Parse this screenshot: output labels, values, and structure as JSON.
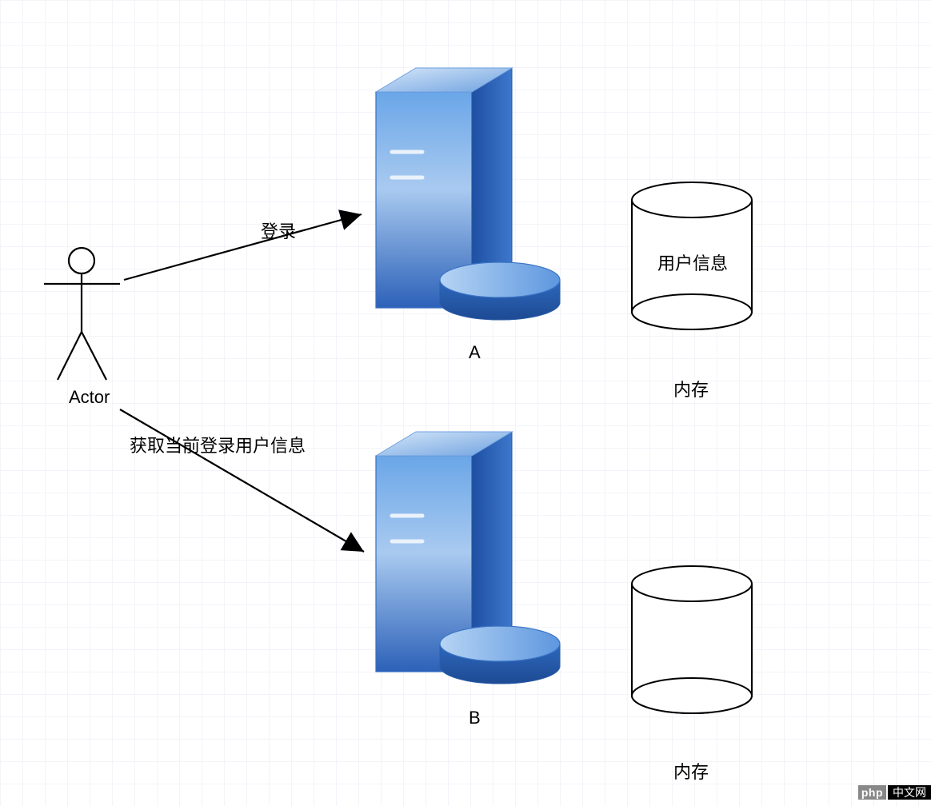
{
  "actor": {
    "label": "Actor"
  },
  "arrows": {
    "login_label": "登录",
    "fetch_user_label": "获取当前登录用户信息"
  },
  "servers": {
    "a_label": "A",
    "b_label": "B"
  },
  "cylinders": {
    "a": {
      "content_label": "用户信息",
      "caption": "内存"
    },
    "b": {
      "content_label": "",
      "caption": "内存"
    }
  },
  "watermark": {
    "brand": "php",
    "suffix": "中文网"
  }
}
